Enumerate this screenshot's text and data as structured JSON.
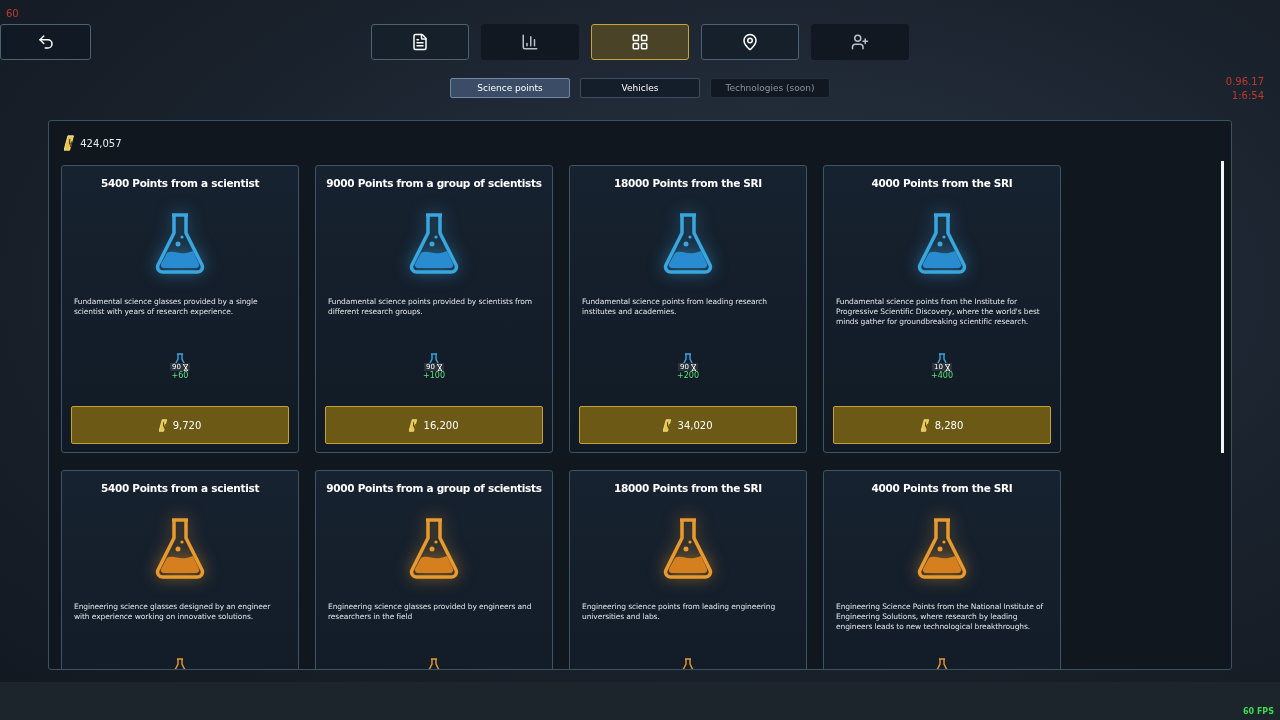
{
  "overlay": {
    "fps_counter": "60",
    "version": "0.96.17",
    "clock": "1:6:54",
    "fps_label": "60 FPS"
  },
  "nav": [
    {
      "kind": "list",
      "selected": false,
      "disabled": false
    },
    {
      "kind": "chart",
      "selected": false,
      "disabled": true
    },
    {
      "kind": "grid",
      "selected": true,
      "disabled": false
    },
    {
      "kind": "pin",
      "selected": false,
      "disabled": false
    },
    {
      "kind": "user",
      "selected": false,
      "disabled": true
    }
  ],
  "subtabs": [
    {
      "label": "Science points",
      "selected": true,
      "disabled": false
    },
    {
      "label": "Vehicles",
      "selected": false,
      "disabled": false
    },
    {
      "label": "Technologies (soon)",
      "selected": false,
      "disabled": true
    }
  ],
  "balance": "424,057",
  "offers": [
    {
      "kind": "fundamental",
      "title": "5400 Points from a scientist",
      "description": "Fundamental science glasses provided by a single scientist with years of research experience.",
      "count": "90",
      "bonus": "+60",
      "price": "9,720"
    },
    {
      "kind": "fundamental",
      "title": "9000 Points from a group of scientists",
      "description": "Fundamental science points provided by scientists from different research groups.",
      "count": "90",
      "bonus": "+100",
      "price": "16,200"
    },
    {
      "kind": "fundamental",
      "title": "18000 Points from the SRI",
      "description": "Fundamental science points from leading research institutes and academies.",
      "count": "90",
      "bonus": "+200",
      "price": "34,020"
    },
    {
      "kind": "fundamental",
      "title": "4000 Points from the SRI",
      "description": "Fundamental science points from the Institute for Progressive Scientific Discovery, where the world's best minds gather for groundbreaking scientific research.",
      "count": "10",
      "bonus": "+400",
      "price": "8,280"
    },
    {
      "kind": "engineering",
      "title": "5400 Points from a scientist",
      "description": "Engineering science glasses designed by an engineer with experience working on innovative solutions."
    },
    {
      "kind": "engineering",
      "title": "9000 Points from a group of scientists",
      "description": "Engineering science glasses provided by engineers and researchers in the field"
    },
    {
      "kind": "engineering",
      "title": "18000 Points from the SRI",
      "description": "Engineering science points from leading engineering universities and labs."
    },
    {
      "kind": "engineering",
      "title": "4000 Points from the SRI",
      "description": "Engineering Science Points from the National Institute of Engineering Solutions, where research by leading engineers leads to new technological breakthroughs."
    }
  ]
}
